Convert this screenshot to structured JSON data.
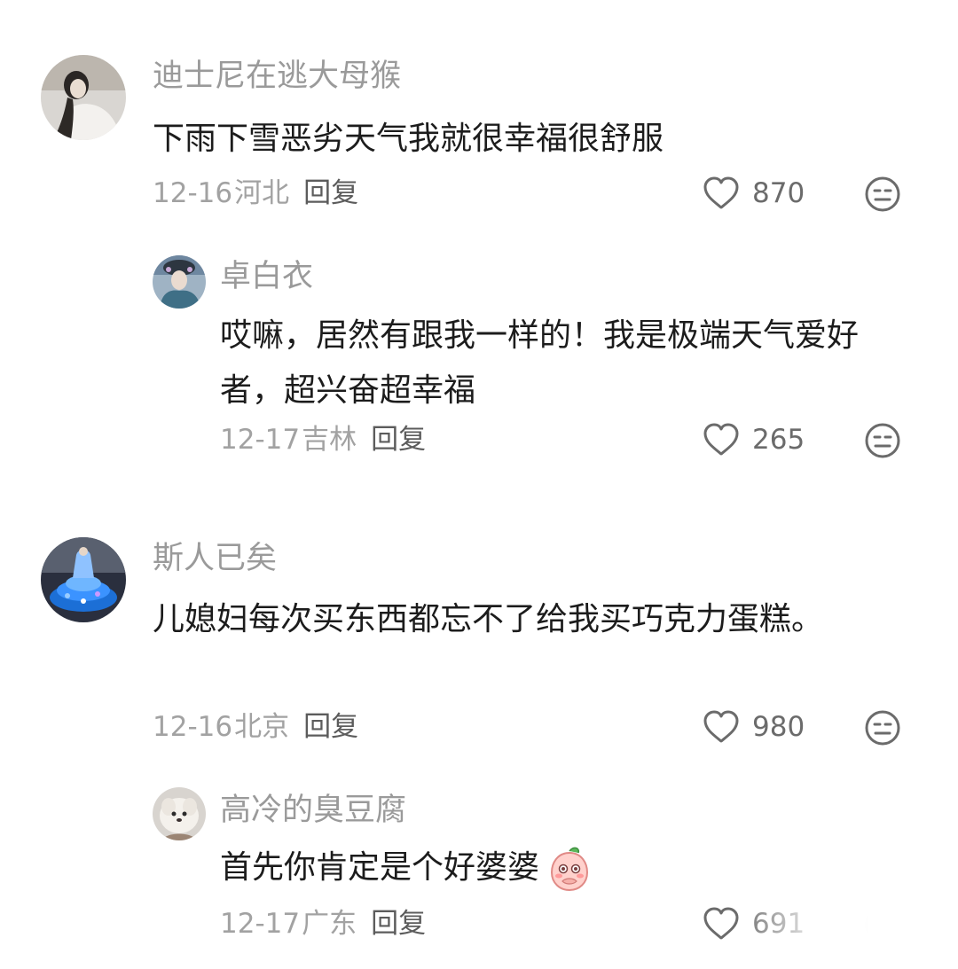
{
  "comments": [
    {
      "author": "迪士尼在逃大母猴",
      "text": "下雨下雪恶劣天气我就很幸福很舒服",
      "date": "12-16",
      "location": "河北",
      "reply_label": "回复",
      "likes": "870",
      "avatar_icon": "user-avatar-photo",
      "replies": [
        {
          "author": "卓白衣",
          "text": "哎嘛，居然有跟我一样的！我是极端天气爱好者，超兴奋超幸福",
          "date": "12-17",
          "location": "吉林",
          "reply_label": "回复",
          "likes": "265",
          "avatar_icon": "user-avatar-photo"
        }
      ]
    },
    {
      "author": "斯人已矣",
      "text": "儿媳妇每次买东西都忘不了给我买巧克力蛋糕。",
      "date": "12-16",
      "location": "北京",
      "reply_label": "回复",
      "likes": "980",
      "avatar_icon": "user-avatar-photo",
      "replies": [
        {
          "author": "高冷的臭豆腐",
          "text": "首先你肯定是个好婆婆",
          "emoji": "peach-shy-emoji",
          "date": "12-17",
          "location": "广东",
          "reply_label": "回复",
          "likes": "691",
          "avatar_icon": "user-avatar-photo"
        }
      ]
    }
  ],
  "colors": {
    "name": "#9a9a9a",
    "text": "#1c1c1c",
    "meta": "#a2a2a2",
    "reply": "#5c5c5c",
    "icon": "#6b6b6b"
  }
}
